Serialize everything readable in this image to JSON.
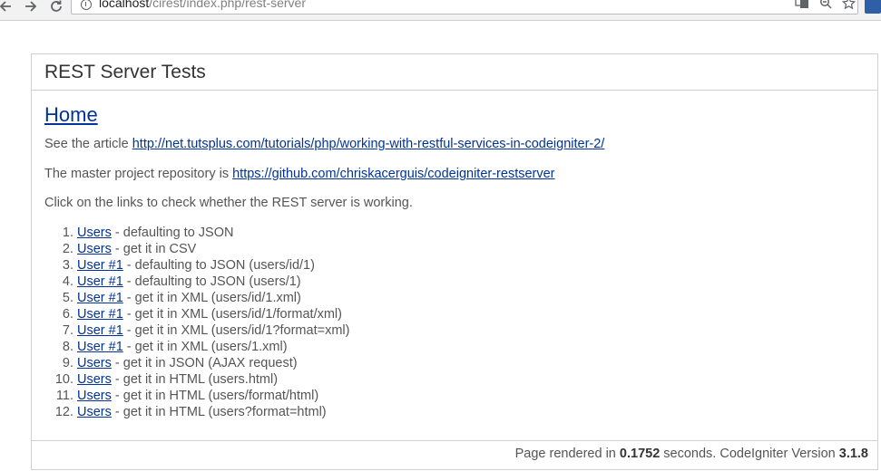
{
  "browser": {
    "url_host": "localhost",
    "url_path": "/cirest/index.php/rest-server"
  },
  "page": {
    "title": "REST Server Tests",
    "home_link": "Home",
    "article_prefix": "See the article ",
    "article_url": "http://net.tutsplus.com/tutorials/php/working-with-restful-services-in-codeigniter-2/",
    "repo_prefix": "The master project repository is ",
    "repo_url": "https://github.com/chriskacerguis/codeigniter-restserver",
    "instructions": "Click on the links to check whether the REST server is working.",
    "tests": [
      {
        "link": "Users",
        "desc": " - defaulting to JSON"
      },
      {
        "link": "Users",
        "desc": " - get it in CSV"
      },
      {
        "link": "User #1",
        "desc": " - defaulting to JSON (users/id/1)"
      },
      {
        "link": "User #1",
        "desc": " - defaulting to JSON (users/1)"
      },
      {
        "link": "User #1",
        "desc": " - get it in XML (users/id/1.xml)"
      },
      {
        "link": "User #1",
        "desc": " - get it in XML (users/id/1/format/xml)"
      },
      {
        "link": "User #1",
        "desc": " - get it in XML (users/id/1?format=xml)"
      },
      {
        "link": "User #1",
        "desc": " - get it in XML (users/1.xml)"
      },
      {
        "link": "Users",
        "desc": " - get it in JSON (AJAX request)"
      },
      {
        "link": "Users",
        "desc": " - get it in HTML (users.html)"
      },
      {
        "link": "Users",
        "desc": " - get it in HTML (users/format/html)"
      },
      {
        "link": "Users",
        "desc": " - get it in HTML (users?format=html)"
      }
    ],
    "footer": {
      "prefix": "Page rendered in ",
      "time": "0.1752",
      "middle": " seconds. CodeIgniter Version ",
      "version": "3.1.8"
    }
  },
  "colors": {
    "link": "#003399",
    "text": "#555555",
    "border": "#d0d0d0"
  }
}
